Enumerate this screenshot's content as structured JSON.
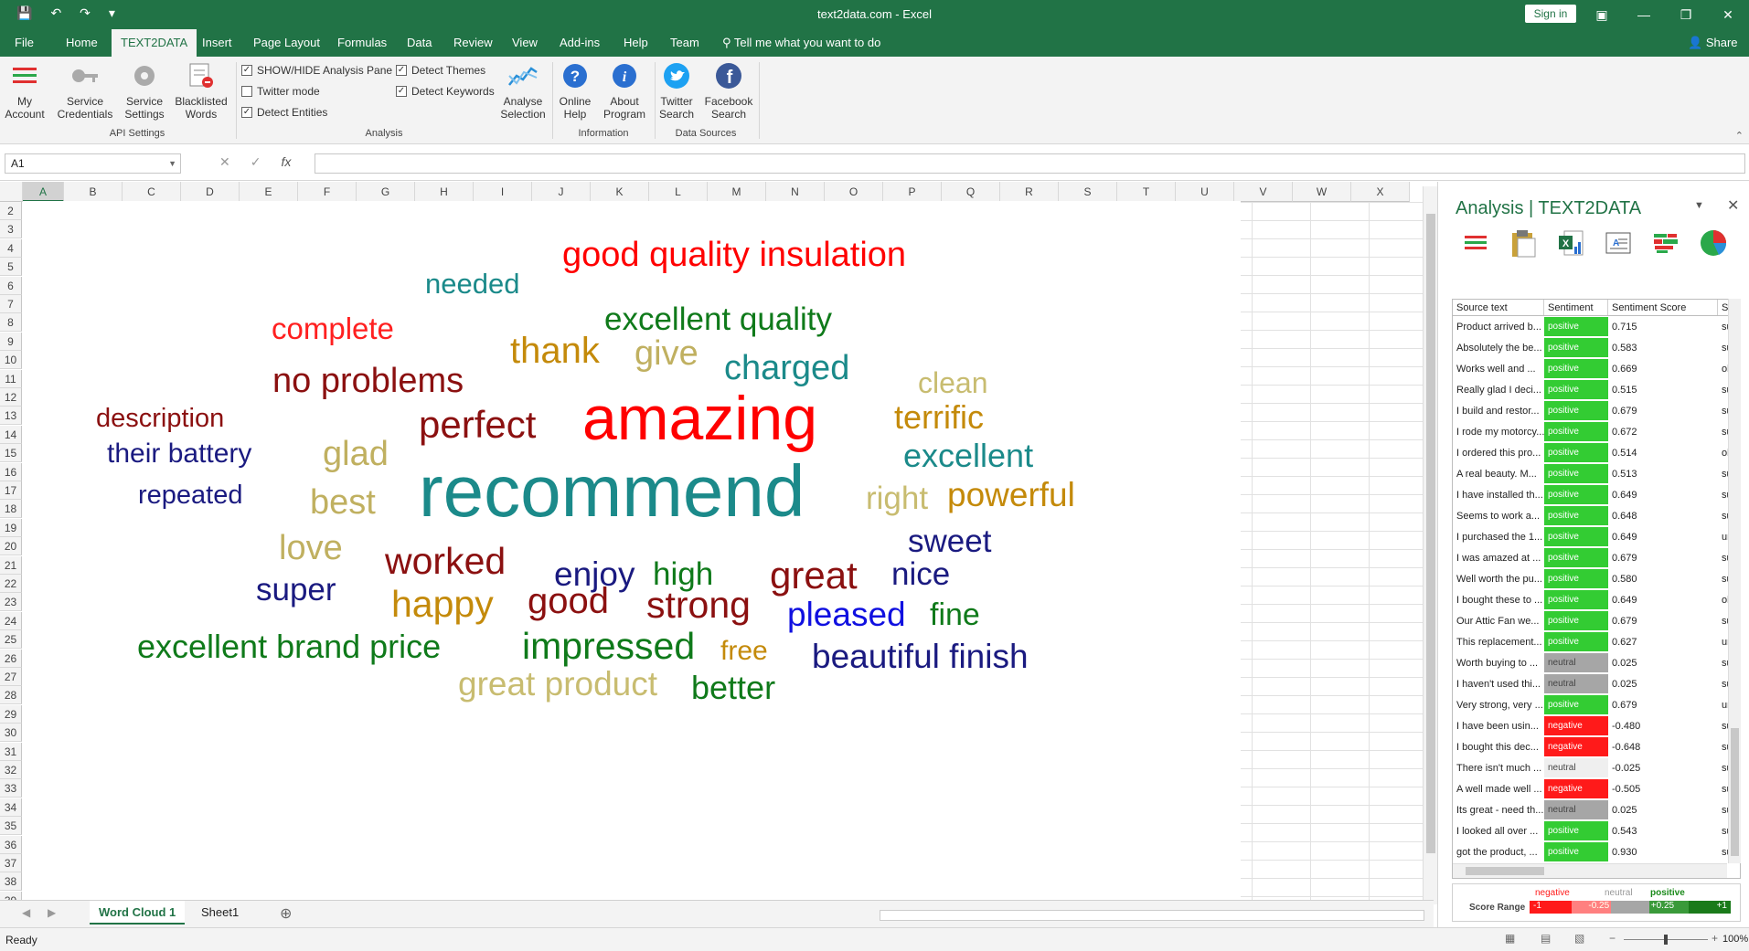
{
  "window": {
    "title": "text2data.com  -  Excel",
    "sign_in": "Sign in",
    "share": "Share"
  },
  "menu": {
    "tabs": [
      "File",
      "Home",
      "TEXT2DATA",
      "Insert",
      "Page Layout",
      "Formulas",
      "Data",
      "Review",
      "View",
      "Add-ins",
      "Help",
      "Team"
    ],
    "tell_me": "Tell me what you want to do"
  },
  "ribbon": {
    "my_account": "My Account",
    "service_credentials": "Service Credentials",
    "service_settings": "Service Settings",
    "blacklisted_words": "Blacklisted Words",
    "api_settings_label": "API Settings",
    "checks": {
      "show_hide": "SHOW/HIDE Analysis Pane",
      "twitter_mode": "Twitter mode",
      "detect_entities": "Detect Entities",
      "detect_themes": "Detect Themes",
      "detect_keywords": "Detect Keywords"
    },
    "analyse_selection": "Analyse Selection",
    "analysis_label": "Analysis",
    "online_help": "Online Help",
    "about_program": "About Program",
    "information_label": "Information",
    "twitter_search": "Twitter Search",
    "facebook_search": "Facebook Search",
    "data_sources_label": "Data Sources"
  },
  "formula_bar": {
    "name_box": "A1",
    "fx": "fx"
  },
  "columns": [
    "A",
    "B",
    "C",
    "D",
    "E",
    "F",
    "G",
    "H",
    "I",
    "J",
    "K",
    "L",
    "M",
    "N",
    "O",
    "P",
    "Q",
    "R",
    "S",
    "T",
    "U",
    "V",
    "W",
    "X"
  ],
  "rows": [
    "2",
    "3",
    "4",
    "5",
    "6",
    "7",
    "8",
    "9",
    "10",
    "11",
    "12",
    "13",
    "14",
    "15",
    "16",
    "17",
    "18",
    "19",
    "20",
    "21",
    "22",
    "23",
    "24",
    "25",
    "26",
    "27",
    "28",
    "29",
    "30",
    "31",
    "32",
    "33",
    "34",
    "35",
    "36",
    "37",
    "38",
    "39"
  ],
  "word_cloud": [
    {
      "text": "good quality insulation",
      "color": "#ff0000"
    },
    {
      "text": "needed",
      "color": "#1b8a8a"
    },
    {
      "text": "excellent quality",
      "color": "#0f7a1a"
    },
    {
      "text": "complete",
      "color": "#ff2020"
    },
    {
      "text": "thank",
      "color": "#c48a0a"
    },
    {
      "text": "give",
      "color": "#c0b060"
    },
    {
      "text": "charged",
      "color": "#1b8a8a"
    },
    {
      "text": "clean",
      "color": "#c8bc70"
    },
    {
      "text": "no problems",
      "color": "#8b1010"
    },
    {
      "text": "description",
      "color": "#8b1010"
    },
    {
      "text": "perfect",
      "color": "#8b1010"
    },
    {
      "text": "amazing",
      "color": "#ff0000"
    },
    {
      "text": "terrific",
      "color": "#c48a0a"
    },
    {
      "text": "their battery",
      "color": "#1a1a80"
    },
    {
      "text": "glad",
      "color": "#c0b060"
    },
    {
      "text": "excellent",
      "color": "#1b8a8a"
    },
    {
      "text": "repeated",
      "color": "#1a1a80"
    },
    {
      "text": "best",
      "color": "#c0b060"
    },
    {
      "text": "recommend",
      "color": "#1b8a8a"
    },
    {
      "text": "right",
      "color": "#c8bc70"
    },
    {
      "text": "powerful",
      "color": "#c48a0a"
    },
    {
      "text": "sweet",
      "color": "#1a1a80"
    },
    {
      "text": "love",
      "color": "#c0b060"
    },
    {
      "text": "worked",
      "color": "#8b1010"
    },
    {
      "text": "enjoy",
      "color": "#1a1a80"
    },
    {
      "text": "high",
      "color": "#0f7a1a"
    },
    {
      "text": "great",
      "color": "#8b1010"
    },
    {
      "text": "nice",
      "color": "#1a1a80"
    },
    {
      "text": "super",
      "color": "#1a1a80"
    },
    {
      "text": "happy",
      "color": "#c48a0a"
    },
    {
      "text": "good",
      "color": "#8b1010"
    },
    {
      "text": "strong",
      "color": "#8b1010"
    },
    {
      "text": "pleased",
      "color": "#1010e0"
    },
    {
      "text": "fine",
      "color": "#0f7a1a"
    },
    {
      "text": "excellent brand price",
      "color": "#0f7a1a"
    },
    {
      "text": "impressed",
      "color": "#0f7a1a"
    },
    {
      "text": "free",
      "color": "#c48a0a"
    },
    {
      "text": "beautiful finish",
      "color": "#1a1a80"
    },
    {
      "text": "great product",
      "color": "#c8bc70"
    },
    {
      "text": "better",
      "color": "#0f7a1a"
    }
  ],
  "sheets": [
    "Word Cloud 1",
    "Sheet1"
  ],
  "status": {
    "ready": "Ready",
    "zoom": "100%"
  },
  "pane": {
    "title": "Analysis | TEXT2DATA",
    "headers": [
      "Source text",
      "Sentiment",
      "Sentiment Score",
      "Su"
    ],
    "rows": [
      {
        "text": "Product arrived b...",
        "sentiment": "positive",
        "score": "0.715",
        "sub": "sub"
      },
      {
        "text": "Absolutely the be...",
        "sentiment": "positive",
        "score": "0.583",
        "sub": "sub"
      },
      {
        "text": "Works well and ...",
        "sentiment": "positive",
        "score": "0.669",
        "sub": "obj"
      },
      {
        "text": "Really glad I deci...",
        "sentiment": "positive",
        "score": "0.515",
        "sub": "sub"
      },
      {
        "text": "I build and restor...",
        "sentiment": "positive",
        "score": "0.679",
        "sub": "sub"
      },
      {
        "text": "I rode my motorcy...",
        "sentiment": "positive",
        "score": "0.672",
        "sub": "sub"
      },
      {
        "text": "I ordered this pro...",
        "sentiment": "positive",
        "score": "0.514",
        "sub": "obj"
      },
      {
        "text": "A real beauty.  M...",
        "sentiment": "positive",
        "score": "0.513",
        "sub": "sub"
      },
      {
        "text": "I have installed th...",
        "sentiment": "positive",
        "score": "0.649",
        "sub": "sub"
      },
      {
        "text": "Seems to work a...",
        "sentiment": "positive",
        "score": "0.648",
        "sub": "sub"
      },
      {
        "text": "I purchased the 1...",
        "sentiment": "positive",
        "score": "0.649",
        "sub": "unl"
      },
      {
        "text": "I was amazed at ...",
        "sentiment": "positive",
        "score": "0.679",
        "sub": "sub"
      },
      {
        "text": "Well worth the pu...",
        "sentiment": "positive",
        "score": "0.580",
        "sub": "sub"
      },
      {
        "text": "I bought these to ...",
        "sentiment": "positive",
        "score": "0.649",
        "sub": "obj"
      },
      {
        "text": "Our Attic Fan we...",
        "sentiment": "positive",
        "score": "0.679",
        "sub": "sub"
      },
      {
        "text": "This replacement...",
        "sentiment": "positive",
        "score": "0.627",
        "sub": "unl"
      },
      {
        "text": "Worth buying to ...",
        "sentiment": "neutral",
        "score": "0.025",
        "sub": "sub"
      },
      {
        "text": "I haven't used thi...",
        "sentiment": "neutral",
        "score": "0.025",
        "sub": "sub"
      },
      {
        "text": "Very strong, very ...",
        "sentiment": "positive",
        "score": "0.679",
        "sub": "unl"
      },
      {
        "text": "I have been usin...",
        "sentiment": "negative",
        "score": "-0.480",
        "sub": "sub"
      },
      {
        "text": "I bought this dec...",
        "sentiment": "negative",
        "score": "-0.648",
        "sub": "sub"
      },
      {
        "text": "There isn't much ...",
        "sentiment": "neutral",
        "score": "-0.025",
        "sub": "sub"
      },
      {
        "text": "A well made well ...",
        "sentiment": "negative",
        "score": "-0.505",
        "sub": "sub"
      },
      {
        "text": "Its great - need th...",
        "sentiment": "neutral",
        "score": "0.025",
        "sub": "sub"
      },
      {
        "text": "I looked all over ...",
        "sentiment": "positive",
        "score": "0.543",
        "sub": "sub"
      },
      {
        "text": "got the product, ...",
        "sentiment": "positive",
        "score": "0.930",
        "sub": "sub"
      }
    ],
    "legend": {
      "label": "Score Range",
      "negative": "negative",
      "neutral": "neutral",
      "positive": "positive",
      "ticks": [
        "-1",
        "-0.25",
        "+0.25",
        "+1"
      ]
    }
  },
  "colors": {
    "accent": "#217346",
    "positive": "#33cc33",
    "neutral": "#a6a6a6",
    "negative": "#ff1a1a"
  }
}
